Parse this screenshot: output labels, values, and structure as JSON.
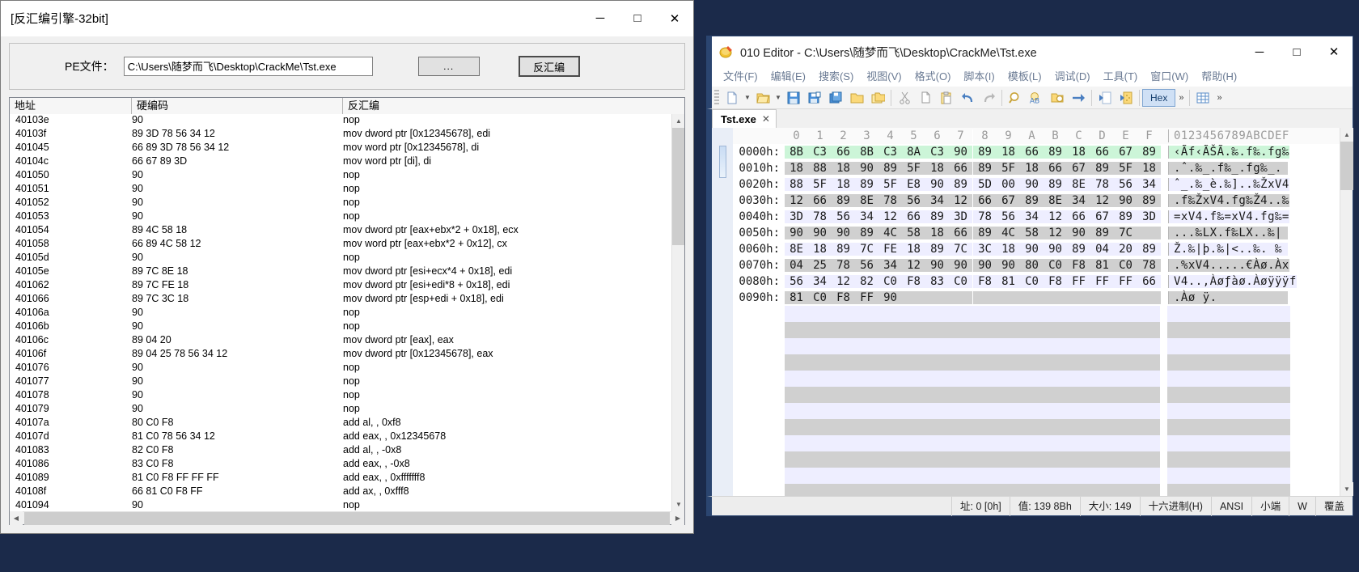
{
  "disasm_window": {
    "title": "[反汇编引擎-32bit]",
    "window_buttons": {
      "minimize": "─",
      "maximize": "□",
      "close": "✕"
    },
    "pe_label": "PE文件：",
    "pe_path": "C:\\Users\\随梦而飞\\Desktop\\CrackMe\\Tst.exe",
    "browse_label": "...",
    "disasm_label": "反汇编",
    "columns": [
      "地址",
      "硬编码",
      "反汇编"
    ],
    "rows": [
      {
        "addr": "40103e",
        "hex": "90",
        "asm": "nop"
      },
      {
        "addr": "40103f",
        "hex": "89 3D 78 56 34 12",
        "asm": "mov dword ptr [0x12345678], edi"
      },
      {
        "addr": "401045",
        "hex": "66 89 3D 78 56 34 12",
        "asm": "mov word ptr [0x12345678], di"
      },
      {
        "addr": "40104c",
        "hex": "66 67 89 3D",
        "asm": "mov word ptr [di], di"
      },
      {
        "addr": "401050",
        "hex": "90",
        "asm": "nop"
      },
      {
        "addr": "401051",
        "hex": "90",
        "asm": "nop"
      },
      {
        "addr": "401052",
        "hex": "90",
        "asm": "nop"
      },
      {
        "addr": "401053",
        "hex": "90",
        "asm": "nop"
      },
      {
        "addr": "401054",
        "hex": "89 4C 58 18",
        "asm": "mov dword ptr [eax+ebx*2 + 0x18], ecx"
      },
      {
        "addr": "401058",
        "hex": "66 89 4C 58 12",
        "asm": "mov word ptr [eax+ebx*2 + 0x12], cx"
      },
      {
        "addr": "40105d",
        "hex": "90",
        "asm": "nop"
      },
      {
        "addr": "40105e",
        "hex": "89 7C 8E 18",
        "asm": "mov dword ptr [esi+ecx*4 + 0x18], edi"
      },
      {
        "addr": "401062",
        "hex": "89 7C FE 18",
        "asm": "mov dword ptr [esi+edi*8 + 0x18], edi"
      },
      {
        "addr": "401066",
        "hex": "89 7C 3C 18",
        "asm": "mov dword ptr [esp+edi + 0x18], edi"
      },
      {
        "addr": "40106a",
        "hex": "90",
        "asm": "nop"
      },
      {
        "addr": "40106b",
        "hex": "90",
        "asm": "nop"
      },
      {
        "addr": "40106c",
        "hex": "89 04 20",
        "asm": "mov dword ptr [eax], eax"
      },
      {
        "addr": "40106f",
        "hex": "89 04 25 78 56 34 12",
        "asm": "mov dword ptr [0x12345678], eax"
      },
      {
        "addr": "401076",
        "hex": "90",
        "asm": "nop"
      },
      {
        "addr": "401077",
        "hex": "90",
        "asm": "nop"
      },
      {
        "addr": "401078",
        "hex": "90",
        "asm": "nop"
      },
      {
        "addr": "401079",
        "hex": "90",
        "asm": "nop"
      },
      {
        "addr": "40107a",
        "hex": "80 C0 F8",
        "asm": "add al, , 0xf8"
      },
      {
        "addr": "40107d",
        "hex": "81 C0 78 56 34 12",
        "asm": "add eax, , 0x12345678"
      },
      {
        "addr": "401083",
        "hex": "82 C0 F8",
        "asm": "add al, , -0x8"
      },
      {
        "addr": "401086",
        "hex": "83 C0 F8",
        "asm": "add eax, , -0x8"
      },
      {
        "addr": "401089",
        "hex": "81 C0 F8 FF FF FF",
        "asm": "add eax, , 0xfffffff8"
      },
      {
        "addr": "40108f",
        "hex": "66 81 C0 F8 FF",
        "asm": "add ax, , 0xfff8"
      },
      {
        "addr": "401094",
        "hex": "90",
        "asm": "nop"
      }
    ]
  },
  "editor_window": {
    "title": "010 Editor - C:\\Users\\随梦而飞\\Desktop\\CrackMe\\Tst.exe",
    "app_icon": "010-editor-icon",
    "window_buttons": {
      "minimize": "─",
      "maximize": "□",
      "close": "✕"
    },
    "menus": [
      "文件(F)",
      "编辑(E)",
      "搜索(S)",
      "视图(V)",
      "格式(O)",
      "脚本(I)",
      "模板(L)",
      "调试(D)",
      "工具(T)",
      "窗口(W)",
      "帮助(H)"
    ],
    "toolbar": {
      "buttons": [
        "new-file-icon",
        "new-file-dropdown-caret",
        "open-file-icon",
        "open-file-dropdown-caret",
        "save-icon",
        "save-as-icon",
        "save-all-icon",
        "close-file-icon",
        "close-all-icon",
        "cut-icon",
        "copy-icon",
        "paste-icon",
        "undo-icon",
        "redo-icon",
        "find-icon",
        "replace-icon",
        "find-in-files-icon",
        "goto-icon",
        "run-script-icon",
        "run-template-icon"
      ],
      "hex_label": "Hex",
      "overflow_chevron": "»",
      "table_icon": "table-icon",
      "overflow_chevron2": "»"
    },
    "tab": {
      "label": "Tst.exe",
      "close": "✕"
    },
    "hex_view": {
      "column_headers": [
        "0",
        "1",
        "2",
        "3",
        "4",
        "5",
        "6",
        "7",
        "8",
        "9",
        "A",
        "B",
        "C",
        "D",
        "E",
        "F"
      ],
      "ascii_header": "0123456789ABCDEF",
      "rows": [
        {
          "offset": "0000h:",
          "bytes": [
            "8B",
            "C3",
            "66",
            "8B",
            "C3",
            "8A",
            "C3",
            "90",
            "89",
            "18",
            "66",
            "89",
            "18",
            "66",
            "67",
            "89"
          ],
          "ascii": "‹Ãf‹ÃŠÃ.‰.f‰.fg‰",
          "style": "sel"
        },
        {
          "offset": "0010h:",
          "bytes": [
            "18",
            "88",
            "18",
            "90",
            "89",
            "5F",
            "18",
            "66",
            "89",
            "5F",
            "18",
            "66",
            "67",
            "89",
            "5F",
            "18"
          ],
          "ascii": ".ˆ.‰_.f‰_.fg‰_.",
          "style": "odd"
        },
        {
          "offset": "0020h:",
          "bytes": [
            "88",
            "5F",
            "18",
            "89",
            "5F",
            "E8",
            "90",
            "89",
            "5D",
            "00",
            "90",
            "89",
            "8E",
            "78",
            "56",
            "34"
          ],
          "ascii": "ˆ_.‰_è.‰]..‰ŽxV4",
          "style": "lilac"
        },
        {
          "offset": "0030h:",
          "bytes": [
            "12",
            "66",
            "89",
            "8E",
            "78",
            "56",
            "34",
            "12",
            "66",
            "67",
            "89",
            "8E",
            "34",
            "12",
            "90",
            "89"
          ],
          "ascii": ".f‰ŽxV4.fg‰Ž4..‰",
          "style": "odd"
        },
        {
          "offset": "0040h:",
          "bytes": [
            "3D",
            "78",
            "56",
            "34",
            "12",
            "66",
            "89",
            "3D",
            "78",
            "56",
            "34",
            "12",
            "66",
            "67",
            "89",
            "3D"
          ],
          "ascii": "=xV4.f‰=xV4.fg‰=",
          "style": "lilac"
        },
        {
          "offset": "0050h:",
          "bytes": [
            "90",
            "90",
            "90",
            "89",
            "4C",
            "58",
            "18",
            "66",
            "89",
            "4C",
            "58",
            "12",
            "90",
            "89",
            "7C"
          ],
          "ascii": "...‰LX.f‰LX..‰|",
          "style": "odd"
        },
        {
          "offset": "0060h:",
          "bytes": [
            "8E",
            "18",
            "89",
            "7C",
            "FE",
            "18",
            "89",
            "7C",
            "3C",
            "18",
            "90",
            "90",
            "89",
            "04",
            "20",
            "89"
          ],
          "ascii": "Ž.‰|þ.‰|<..‰. ‰",
          "style": "lilac"
        },
        {
          "offset": "0070h:",
          "bytes": [
            "04",
            "25",
            "78",
            "56",
            "34",
            "12",
            "90",
            "90",
            "90",
            "90",
            "80",
            "C0",
            "F8",
            "81",
            "C0",
            "78"
          ],
          "ascii": ".%xV4.....€Àø.Àx",
          "style": "odd"
        },
        {
          "offset": "0080h:",
          "bytes": [
            "56",
            "34",
            "12",
            "82",
            "C0",
            "F8",
            "83",
            "C0",
            "F8",
            "81",
            "C0",
            "F8",
            "FF",
            "FF",
            "FF",
            "66"
          ],
          "ascii": "V4..‚Àøƒàø.Àøÿÿÿf",
          "style": "lilac"
        },
        {
          "offset": "0090h:",
          "bytes": [
            "81",
            "C0",
            "F8",
            "FF",
            "90"
          ],
          "ascii": ".Àø ÿ.",
          "style": "odd"
        }
      ],
      "blank_row_count": 13
    },
    "status_bar": {
      "address": "址: 0 [0h]",
      "value": "值: 139 8Bh",
      "size": "大小: 149",
      "base": "十六进制(H)",
      "charset": "ANSI",
      "endian": "小端",
      "mode_w": "W",
      "mode_overwrite": "覆盖"
    }
  },
  "colors": {
    "desktop": "#1b2a4a",
    "selection_green": "#ccf5d8",
    "accent_blue": "#2b4570",
    "row_gray": "#d0d0d0",
    "row_lilac": "#eeeeff"
  }
}
